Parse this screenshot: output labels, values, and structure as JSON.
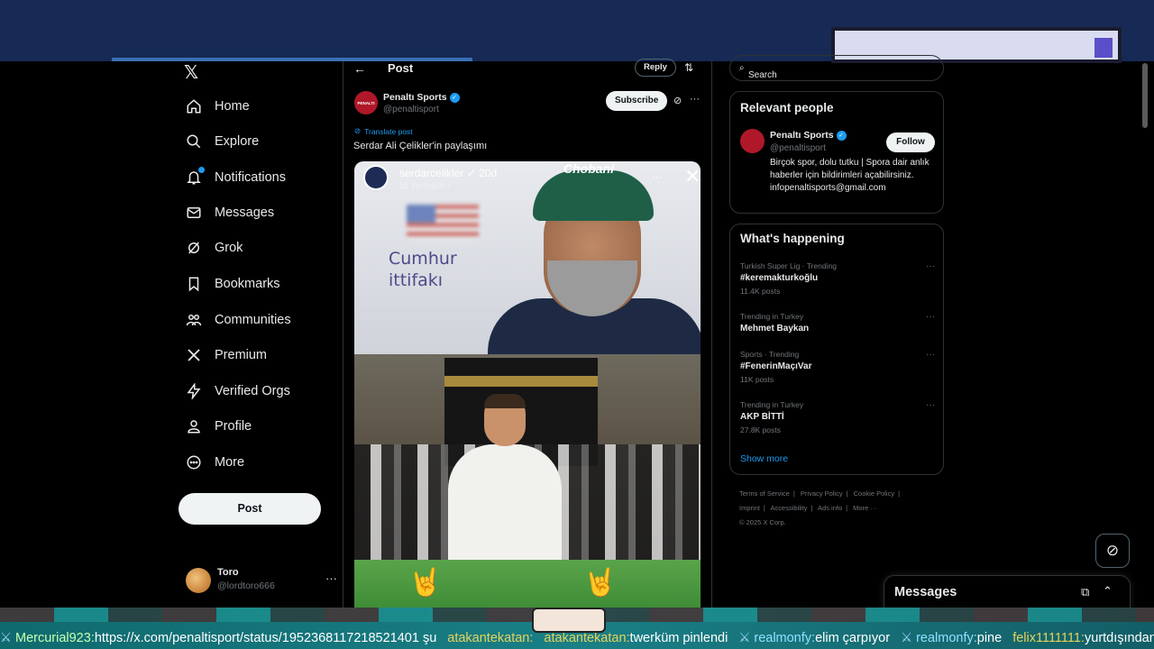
{
  "sidebar": {
    "items": [
      {
        "label": "Home",
        "icon": "home-icon"
      },
      {
        "label": "Explore",
        "icon": "search-icon"
      },
      {
        "label": "Notifications",
        "icon": "bell-icon"
      },
      {
        "label": "Messages",
        "icon": "envelope-icon"
      },
      {
        "label": "Grok",
        "icon": "grok-icon"
      },
      {
        "label": "Bookmarks",
        "icon": "bookmark-icon"
      },
      {
        "label": "Communities",
        "icon": "people-icon"
      },
      {
        "label": "Premium",
        "icon": "x-icon"
      },
      {
        "label": "Verified Orgs",
        "icon": "lightning-icon"
      },
      {
        "label": "Profile",
        "icon": "person-icon"
      },
      {
        "label": "More",
        "icon": "more-circle-icon"
      }
    ],
    "post_button": "Post",
    "account": {
      "name": "Toro",
      "handle": "@lordtoro666",
      "more": "···"
    }
  },
  "main": {
    "title": "Post",
    "reply_button": "Reply",
    "post": {
      "author_name": "Penaltı Sports",
      "author_handle": "@penaltisport",
      "avatar_text": "PENALTI",
      "subscribe_label": "Subscribe",
      "translate_label": "Translate post",
      "text": "Serdar Ali Çelikler'in paylaşımı",
      "media": {
        "ig_user": "serdarcelikler",
        "ig_time": "20d",
        "ig_location": "Yerleşim",
        "cap_text": "Chobani",
        "overlay_line1": "Cumhur",
        "overlay_line2": "ittifakı"
      }
    }
  },
  "right": {
    "search_placeholder": "Search",
    "relevant": {
      "title": "Relevant people",
      "name": "Penaltı Sports",
      "handle": "@penaltisport",
      "follow_label": "Follow",
      "bio": "Birçok spor, dolu tutku | Spora dair anlık haberler için bildirimleri açabilirsiniz. infopenaltisports@gmail.com"
    },
    "happening": {
      "title": "What's happening",
      "trends": [
        {
          "meta": "Turkish Super Lig · Trending",
          "name": "#keremakturkoğlu",
          "count": "11.4K posts"
        },
        {
          "meta": "Trending in Turkey",
          "name": "Mehmet Baykan",
          "count": ""
        },
        {
          "meta": "Sports · Trending",
          "name": "#FenerinMaçıVar",
          "count": "11K posts"
        },
        {
          "meta": "Trending in Turkey",
          "name": "AKP BİTTİ",
          "count": "27.8K posts"
        }
      ],
      "show_more": "Show more"
    },
    "footer": {
      "links": [
        "Terms of Service",
        "|",
        "Privacy Policy",
        "|",
        "Cookie Policy",
        "|",
        "Imprint",
        "|",
        "Accessibility",
        "|",
        "Ads info",
        "|",
        "More ···"
      ],
      "copyright": "© 2025 X Corp."
    }
  },
  "messages_drawer": {
    "label": "Messages"
  },
  "chat": {
    "messages": [
      {
        "user": "Mercurial923:",
        "text": "https://x.com/penaltisport/status/1952368117218521401 şu"
      },
      {
        "user": "atakantekatan:",
        "text": ""
      },
      {
        "user": "atakantekatan:",
        "text": "twerküm pinlendi"
      },
      {
        "user": "realmonfy:",
        "text": "elim çarpıyor"
      },
      {
        "user": "realmonfy:",
        "text": "pine"
      },
      {
        "user": "felix1111111:",
        "text": "yurtdışından dönünce"
      }
    ]
  }
}
